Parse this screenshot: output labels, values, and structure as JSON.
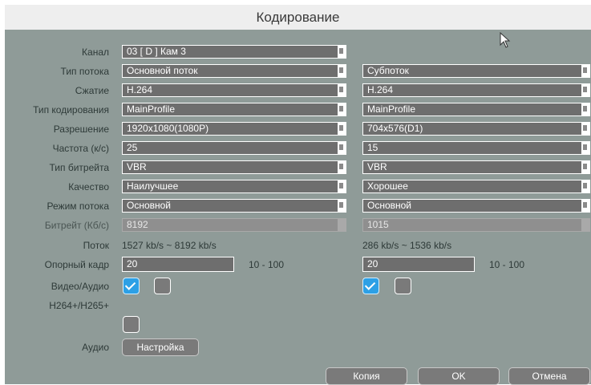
{
  "window": {
    "title": "Кодирование"
  },
  "fields": [
    {
      "label": "Канал",
      "main": "03 [ D ] Кам 3",
      "sub": ""
    },
    {
      "label": "Тип потока",
      "main": "Основной поток",
      "sub": "Субпоток"
    },
    {
      "label": "Сжатие",
      "main": "H.264",
      "sub": "H.264"
    },
    {
      "label": "Тип кодирования",
      "main": "MainProfile",
      "sub": "MainProfile"
    },
    {
      "label": "Разрешение",
      "main": "1920x1080(1080P)",
      "sub": "704x576(D1)"
    },
    {
      "label": "Частота (к/с)",
      "main": "25",
      "sub": "15"
    },
    {
      "label": "Тип битрейта",
      "main": "VBR",
      "sub": "VBR"
    },
    {
      "label": "Качество",
      "main": "Наилучшее",
      "sub": "Хорошее"
    },
    {
      "label": "Режим потока",
      "main": "Основной",
      "sub": "Основной"
    },
    {
      "label": "Битрейт (Кб/с)",
      "main": "8192",
      "sub": "1015"
    }
  ],
  "stream": {
    "label": "Поток",
    "main": "1527 kb/s ~ 8192 kb/s",
    "sub": "286 kb/s ~ 1536 kb/s"
  },
  "keyframe": {
    "label": "Опорный кадр",
    "main": "20",
    "sub": "20",
    "range": "10 - 100"
  },
  "video_audio": {
    "label": "Видео/Аудио",
    "main_video": true,
    "main_audio": false,
    "sub_video": true,
    "sub_audio": false
  },
  "h264plus": {
    "label": "H264+/H265+",
    "checked": false
  },
  "audio": {
    "label": "Аудио",
    "button": "Настройка"
  },
  "buttons": {
    "copy": "Копия",
    "ok": "OK",
    "cancel": "Отмена"
  },
  "colors": {
    "panel": "#8f9b98",
    "field": "#6e6e6e",
    "check_on": "#2da0e6",
    "title_bar": "#eeeeee"
  },
  "icons": {
    "cursor": "mouse-pointer-icon",
    "dropdown": "dropdown-arrow-icon",
    "check": "checkmark-icon"
  }
}
